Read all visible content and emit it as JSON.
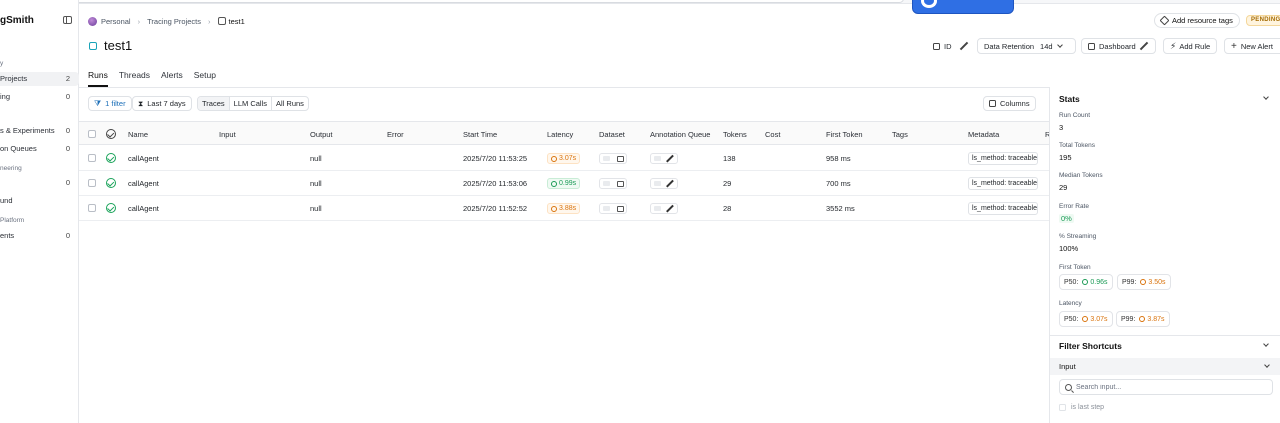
{
  "brand_badge": "",
  "sidebar": {
    "brand": "gSmith",
    "items": [
      {
        "label": "y",
        "count": ""
      },
      {
        "label": "Projects",
        "count": "2"
      },
      {
        "label": "ing",
        "count": "0"
      },
      {
        "label": "s & Experiments",
        "count": "0"
      },
      {
        "label": "on Queues",
        "count": "0"
      },
      {
        "label": "neering",
        "count": ""
      },
      {
        "label": "",
        "count": "0"
      },
      {
        "label": "und",
        "count": ""
      },
      {
        "label": "Platform",
        "count": ""
      },
      {
        "label": "ents",
        "count": "0"
      }
    ]
  },
  "breadcrumb": {
    "org": "Personal",
    "section": "Tracing Projects",
    "current": "test1"
  },
  "page": {
    "title": "test1"
  },
  "header": {
    "id_label": "ID",
    "retention_label": "Data Retention",
    "retention_value": "14d",
    "dashboard_label": "Dashboard",
    "add_rule_label": "Add Rule",
    "new_alert_label": "New Alert",
    "resource_tags_label": "Add resource tags",
    "status_badge": "PENDING"
  },
  "tabs": [
    "Runs",
    "Threads",
    "Alerts",
    "Setup"
  ],
  "filters": {
    "filter_label": "1 filter",
    "range_label": "Last 7 days",
    "segments": [
      "Traces",
      "LLM Calls",
      "All Runs"
    ],
    "columns_label": "Columns"
  },
  "table": {
    "headers": [
      "Name",
      "Input",
      "Output",
      "Error",
      "Start Time",
      "Latency",
      "Dataset",
      "Annotation Queue",
      "Tokens",
      "Cost",
      "First Token",
      "Tags",
      "Metadata",
      "R"
    ],
    "rows": [
      {
        "name": "callAgent",
        "input": "",
        "output": "null",
        "error": "",
        "start": "2025/7/20 11:53:25",
        "latency": "3.07s",
        "latency_state": "warn",
        "tokens": "138",
        "cost": "",
        "first_token": "958 ms",
        "tags": "",
        "metadata": "ls_method: traceable"
      },
      {
        "name": "callAgent",
        "input": "",
        "output": "null",
        "error": "",
        "start": "2025/7/20 11:53:06",
        "latency": "0.99s",
        "latency_state": "good",
        "tokens": "29",
        "cost": "",
        "first_token": "700 ms",
        "tags": "",
        "metadata": "ls_method: traceable"
      },
      {
        "name": "callAgent",
        "input": "",
        "output": "null",
        "error": "",
        "start": "2025/7/20 11:52:52",
        "latency": "3.88s",
        "latency_state": "warn",
        "tokens": "28",
        "cost": "",
        "first_token": "3552 ms",
        "tags": "",
        "metadata": "ls_method: traceable"
      }
    ]
  },
  "stats": {
    "title": "Stats",
    "run_count_label": "Run Count",
    "run_count": "3",
    "total_tokens_label": "Total Tokens",
    "total_tokens": "195",
    "median_tokens_label": "Median Tokens",
    "median_tokens": "29",
    "error_rate_label": "Error Rate",
    "error_rate": "0%",
    "streaming_label": "% Streaming",
    "streaming": "100%",
    "first_token_label": "First Token",
    "first_token_p50_label": "P50:",
    "first_token_p50": "0.96s",
    "first_token_p99_label": "P99:",
    "first_token_p99": "3.50s",
    "latency_label": "Latency",
    "latency_p50_label": "P50:",
    "latency_p50": "3.07s",
    "latency_p99_label": "P99:",
    "latency_p99": "3.87s"
  },
  "filter_shortcuts": {
    "title": "Filter Shortcuts",
    "input_label": "Input",
    "search_placeholder": "Search input...",
    "option_last_step": "is last step"
  },
  "colors": {
    "accent": "#1c6fb8",
    "success": "#1aa35a",
    "warning": "#d9730d",
    "brand_badge": "#2f6fe4"
  }
}
